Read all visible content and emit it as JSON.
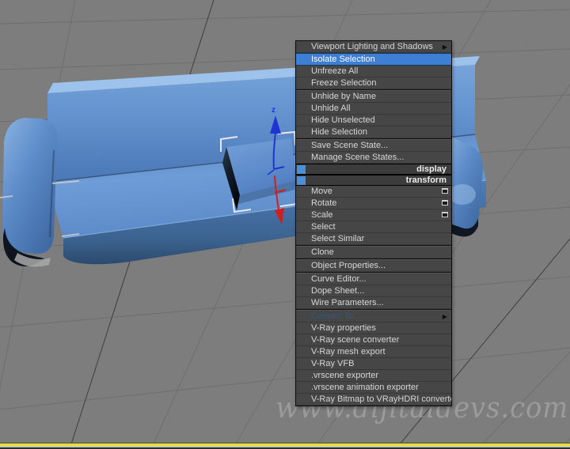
{
  "viewport": {
    "watermark": "www.dijitaldevs.com",
    "gizmo_axis_label": "z",
    "colors": {
      "background": "#7d7d7d",
      "grid_line": "#6e6e6e",
      "grid_axis": "#3e3e3e",
      "object_blue": "#5b8cc8",
      "active_viewport_border": "#e8e22b",
      "z_axis": "#1f35cf",
      "x_axis": "#cf1f1f",
      "selection_bracket": "#e8e8e8"
    }
  },
  "context_menu": {
    "quadrant_titles": [
      {
        "label": "display"
      },
      {
        "label": "transform"
      }
    ],
    "items": [
      {
        "label": "Viewport Lighting and Shadows"
      },
      {
        "label": "Isolate Selection"
      },
      {
        "label": "Unfreeze All"
      },
      {
        "label": "Freeze Selection"
      },
      {
        "label": "Unhide by Name"
      },
      {
        "label": "Unhide All"
      },
      {
        "label": "Hide Unselected"
      },
      {
        "label": "Hide Selection"
      },
      {
        "label": "Save Scene State..."
      },
      {
        "label": "Manage Scene States..."
      },
      {
        "label": "Move"
      },
      {
        "label": "Rotate"
      },
      {
        "label": "Scale"
      },
      {
        "label": "Select"
      },
      {
        "label": "Select Similar"
      },
      {
        "label": "Clone"
      },
      {
        "label": "Object Properties..."
      },
      {
        "label": "Curve Editor..."
      },
      {
        "label": "Dope Sheet..."
      },
      {
        "label": "Wire Parameters..."
      },
      {
        "label": "Convert To:"
      },
      {
        "label": "V-Ray properties"
      },
      {
        "label": "V-Ray scene converter"
      },
      {
        "label": "V-Ray mesh export"
      },
      {
        "label": "V-Ray VFB"
      },
      {
        "label": ".vrscene exporter"
      },
      {
        "label": ".vrscene animation exporter"
      },
      {
        "label": "V-Ray Bitmap to VRayHDRI converter"
      }
    ],
    "colors": {
      "menu_bg": "#464646",
      "item_text": "#d6d6d6",
      "highlight_bg": "#3d7fd4",
      "highlight_text": "#ffffff",
      "disabled_text": "#2e5a7d",
      "quadrant_square": "#4c8fd6"
    }
  }
}
